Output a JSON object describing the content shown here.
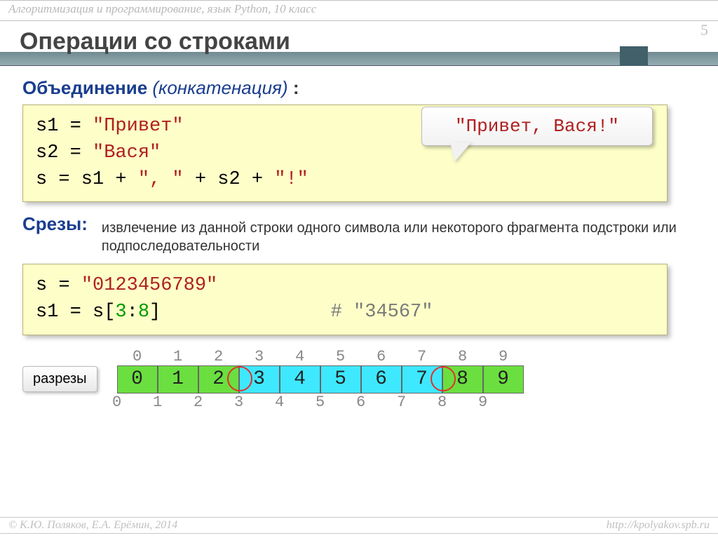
{
  "header": "Алгоритмизация и программирование, язык Python, 10 класс",
  "page_number": "5",
  "title": "Операции со строками",
  "section1": {
    "label": "Объединение",
    "note": "(конкатенация)",
    "colon": " :"
  },
  "code1": {
    "l1_pre": "s1 = ",
    "l1_str": "\"Привет\"",
    "l2_pre": "s2 = ",
    "l2_str": "\"Вася\"",
    "l3_pre": "s  = s1 + ",
    "l3_str1": "\", \"",
    "l3_mid": " + s2 + ",
    "l3_str2": "\"!\""
  },
  "speech": "\"Привет, Вася!\"",
  "section2": {
    "label": "Срезы:",
    "desc": "извлечение из данной строки одного символа или некоторого фрагмента подстроки или подпоследовательности"
  },
  "code2": {
    "l1_pre": "s = ",
    "l1_str": "\"0123456789\"",
    "l2_pre": "s1 = s[",
    "l2_n1": "3",
    "l2_mid": ":",
    "l2_n2": "8",
    "l2_post": "]",
    "l2_comment": "# \"34567\""
  },
  "cut_label": "разрезы",
  "idx_top": [
    "0",
    "1",
    "2",
    "3",
    "4",
    "5",
    "6",
    "7",
    "8",
    "9"
  ],
  "cells": [
    "0",
    "1",
    "2",
    "3",
    "4",
    "5",
    "6",
    "7",
    "8",
    "9"
  ],
  "cell_color": [
    "g",
    "g",
    "g",
    "c",
    "c",
    "c",
    "c",
    "c",
    "g",
    "g"
  ],
  "idx_bottom": [
    "0",
    "1",
    "2",
    "3",
    "4",
    "5",
    "6",
    "7",
    "8",
    "9"
  ],
  "footer_left": "© К.Ю. Поляков, Е.А. Ерёмин, 2014",
  "footer_right": "http://kpolyakov.spb.ru"
}
